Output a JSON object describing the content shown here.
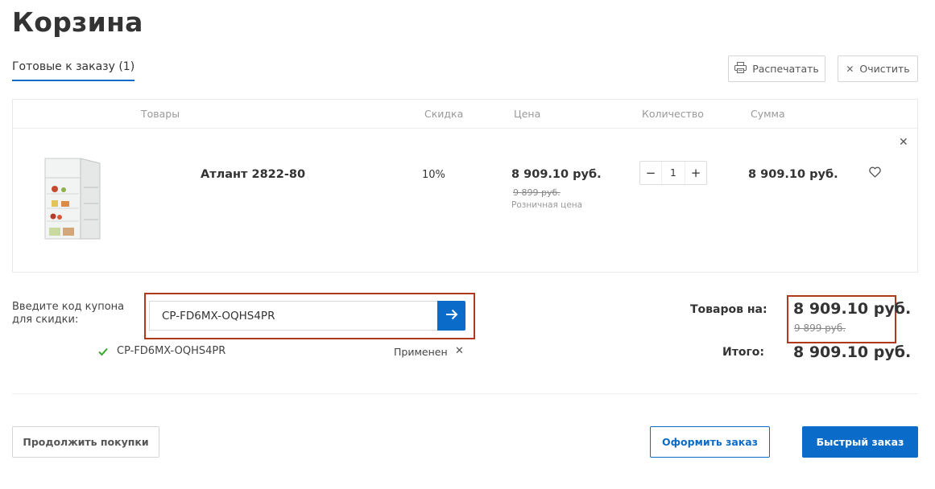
{
  "page": {
    "title": "Корзина"
  },
  "tabs": {
    "ready_label": "Готовые к заказу (1)"
  },
  "toolbar": {
    "print_label": "Распечатать",
    "clear_label": "Очистить"
  },
  "table": {
    "headers": {
      "products": "Товары",
      "discount": "Скидка",
      "price": "Цена",
      "quantity": "Количество",
      "sum": "Сумма"
    },
    "rows": [
      {
        "name": "Атлант 2822-80",
        "discount": "10%",
        "price": "8 909.10 руб.",
        "old_price": "9 899 руб.",
        "price_note": "Розничная цена",
        "quantity": "1",
        "sum": "8 909.10 руб."
      }
    ]
  },
  "coupon": {
    "label": "Введите код купона для скидки:",
    "value": "CP-FD6MX-OQHS4PR",
    "applied_code": "CP-FD6MX-OQHS4PR",
    "applied_status": "Применен"
  },
  "summary": {
    "goods_label": "Товаров на:",
    "goods_value": "8 909.10 руб.",
    "goods_old_value": "9 899 руб.",
    "total_label": "Итого:",
    "total_value": "8 909.10 руб."
  },
  "actions": {
    "continue_label": "Продолжить покупки",
    "checkout_label": "Оформить заказ",
    "quick_label": "Быстрый заказ"
  },
  "icons": {
    "print": "printer-icon",
    "clear": "close-icon",
    "remove": "close-icon",
    "favorite": "heart-icon",
    "submit": "arrow-right-icon",
    "applied": "check-icon"
  },
  "colors": {
    "accent": "#0a6cc8",
    "highlight_frame": "#b0391c",
    "check": "#3aa832"
  }
}
